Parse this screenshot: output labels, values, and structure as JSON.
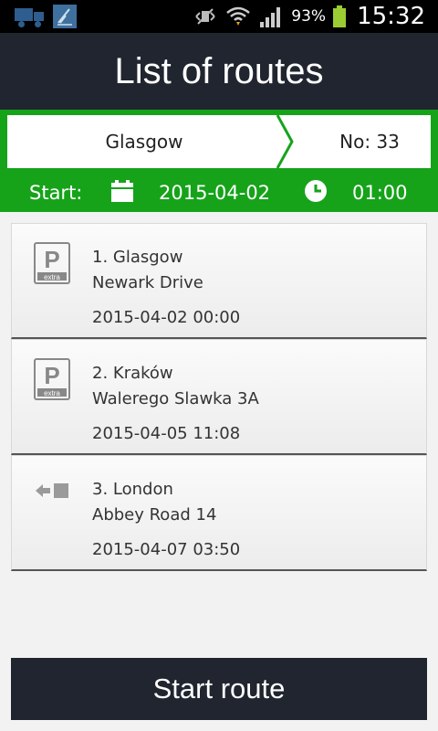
{
  "statusbar": {
    "battery_pct": "93%",
    "time": "15:32"
  },
  "header": {
    "title": "List of routes"
  },
  "route": {
    "from": "Glasgow",
    "number": "No: 33",
    "start_label": "Start:",
    "start_date": "2015-04-02",
    "start_time": "01:00"
  },
  "stops": [
    {
      "icon": "parking-extra-icon",
      "title": "1. Glasgow",
      "address": "Newark Drive",
      "datetime": "2015-04-02 00:00"
    },
    {
      "icon": "parking-extra-icon",
      "title": "2. Kraków",
      "address": "Walerego Slawka 3A",
      "datetime": "2015-04-05 11:08"
    },
    {
      "icon": "unload-arrow-icon",
      "title": "3. London",
      "address": "Abbey Road 14",
      "datetime": "2015-04-07 03:50"
    }
  ],
  "actions": {
    "start_route": "Start route"
  },
  "colors": {
    "header_bg": "#202530",
    "accent_green": "#16a31a"
  }
}
